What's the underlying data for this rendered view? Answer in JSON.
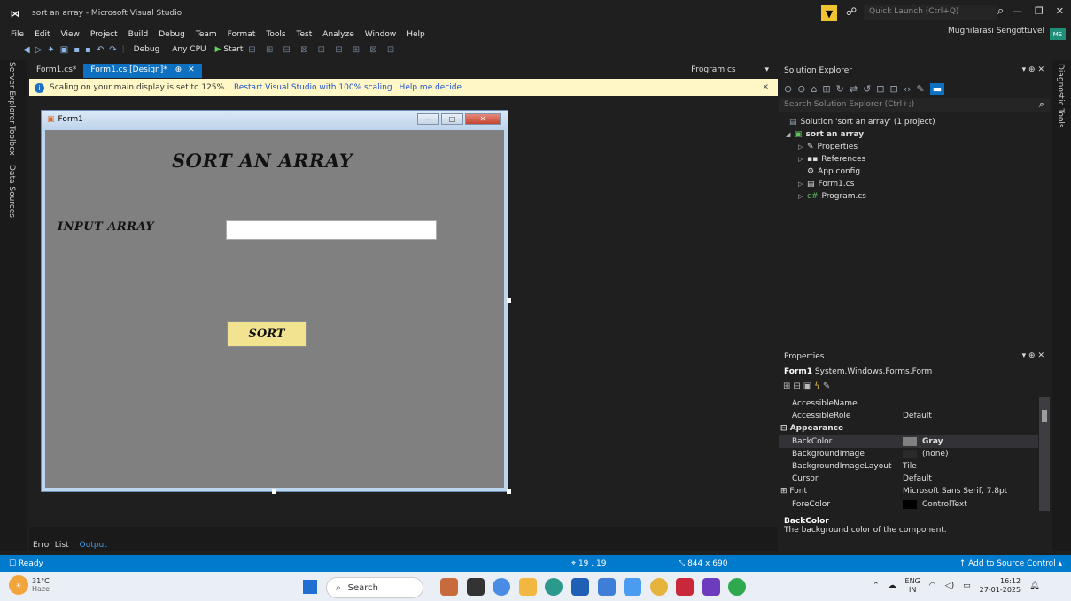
{
  "window": {
    "title": "sort an array - Microsoft Visual Studio",
    "quick_launch_placeholder": "Quick Launch (Ctrl+Q)"
  },
  "menu": [
    "File",
    "Edit",
    "View",
    "Project",
    "Build",
    "Debug",
    "Team",
    "Format",
    "Tools",
    "Test",
    "Analyze",
    "Window",
    "Help"
  ],
  "account": {
    "name": "Mughilarasi Sengottuvel",
    "badge": "MS"
  },
  "toolbar": {
    "config": "Debug",
    "platform": "Any CPU",
    "start": "Start"
  },
  "left_tabs": [
    "Server Explorer",
    "Toolbox",
    "Data Sources"
  ],
  "right_tabs": [
    "Diagnostic Tools"
  ],
  "doc_tabs": [
    {
      "label": "Form1.cs*",
      "active": false
    },
    {
      "label": "Form1.cs [Design]*",
      "active": true
    }
  ],
  "doc_tab_right": "Program.cs",
  "infobar": {
    "message": "Scaling on your main display is set to 125%.",
    "link1": "Restart Visual Studio with 100% scaling",
    "link2": "Help me decide"
  },
  "form": {
    "title": "Form1",
    "heading": "SORT AN ARRAY",
    "input_label": "INPUT ARRAY",
    "input_value": "",
    "sort_button": "SORT"
  },
  "solution_explorer": {
    "title": "Solution Explorer",
    "search_placeholder": "Search Solution Explorer (Ctrl+;)",
    "solution": "Solution 'sort an array' (1 project)",
    "project": "sort an array",
    "items": [
      "Properties",
      "References",
      "App.config",
      "Form1.cs",
      "Program.cs"
    ]
  },
  "properties": {
    "title": "Properties",
    "object_name": "Form1",
    "object_type": "System.Windows.Forms.Form",
    "rows": [
      {
        "name": "AccessibleName",
        "value": ""
      },
      {
        "name": "AccessibleRole",
        "value": "Default"
      },
      {
        "name": "Appearance",
        "value": "",
        "category": true
      },
      {
        "name": "BackColor",
        "value": "Gray",
        "swatch": "#808080",
        "selected": true
      },
      {
        "name": "BackgroundImage",
        "value": "(none)",
        "swatch": "#2a2a2a"
      },
      {
        "name": "BackgroundImageLayout",
        "value": "Tile"
      },
      {
        "name": "Cursor",
        "value": "Default"
      },
      {
        "name": "Font",
        "value": "Microsoft Sans Serif, 7.8pt",
        "expander": true
      },
      {
        "name": "ForeColor",
        "value": "ControlText",
        "swatch": "#000000"
      }
    ],
    "desc_title": "BackColor",
    "desc_text": "The background color of the component."
  },
  "output": {
    "tabs": [
      "Error List",
      "Output"
    ]
  },
  "status": {
    "ready": "Ready",
    "position": "19 , 19",
    "size": "844 x 690",
    "source_control": "Add to Source Control"
  },
  "taskbar": {
    "temp": "31°C",
    "weather": "Haze",
    "search_placeholder": "Search",
    "lang_top": "ENG",
    "lang_bottom": "IN",
    "time": "16:12",
    "date": "27-01-2025"
  }
}
